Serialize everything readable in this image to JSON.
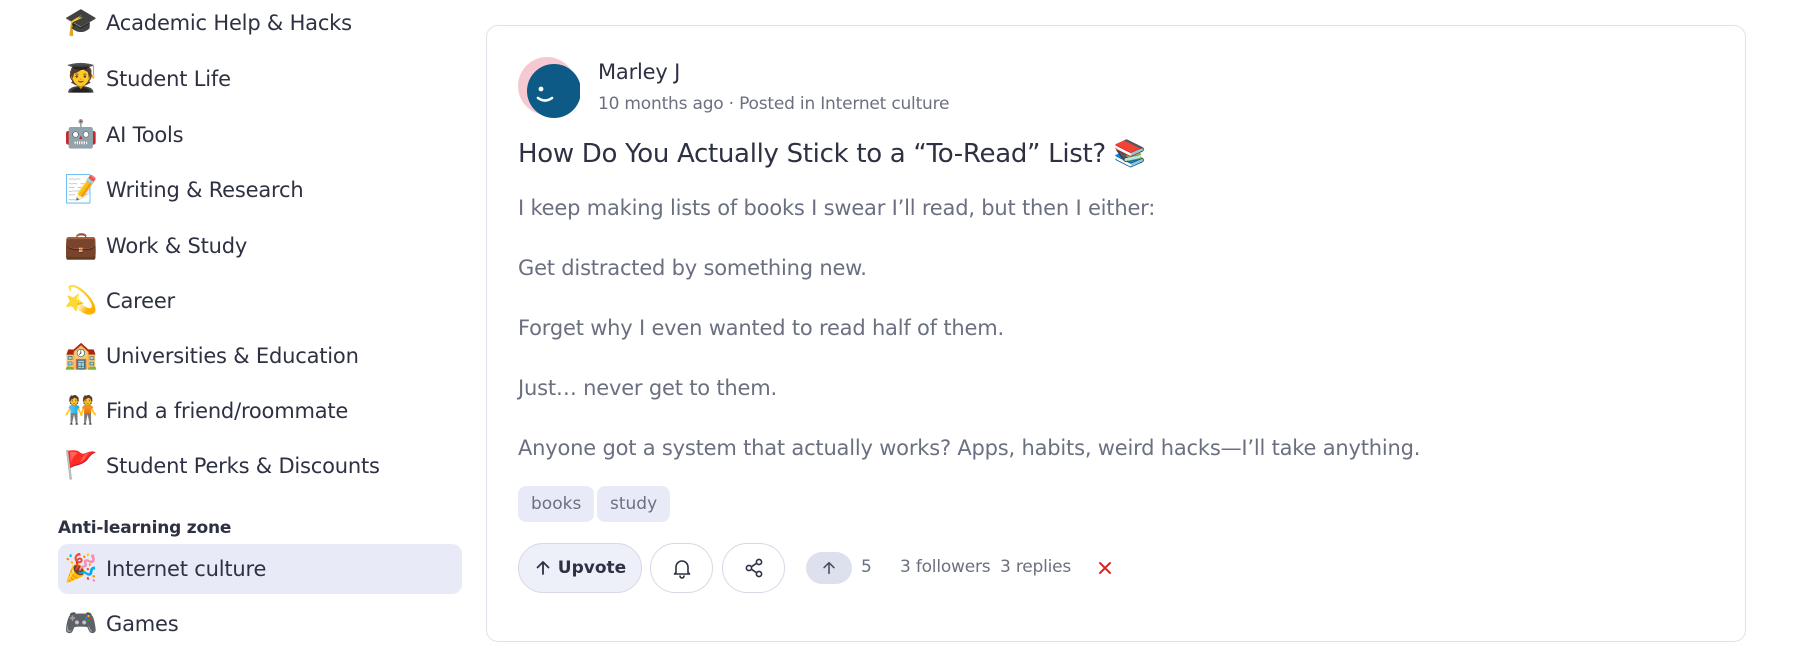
{
  "sidebar": {
    "items": [
      {
        "emoji": "🎓",
        "label": "Academic Help & Hacks"
      },
      {
        "emoji": "🧑‍🎓",
        "label": "Student Life"
      },
      {
        "emoji": "🤖",
        "label": "AI Tools"
      },
      {
        "emoji": "📝",
        "label": "Writing & Research"
      },
      {
        "emoji": "💼",
        "label": "Work & Study"
      },
      {
        "emoji": "💫",
        "label": "Career"
      },
      {
        "emoji": "🏫",
        "label": "Universities & Education"
      },
      {
        "emoji": "🧑‍🤝‍🧑",
        "label": "Find a friend/roommate"
      },
      {
        "emoji": "🚩",
        "label": "Student Perks & Discounts"
      }
    ],
    "section_heading": "Anti-learning zone",
    "zone_items": [
      {
        "emoji": "🎉",
        "label": "Internet culture",
        "active": true
      },
      {
        "emoji": "🎮",
        "label": "Games"
      }
    ]
  },
  "post": {
    "author": "Marley J",
    "meta": "10 months ago · Posted in Internet culture",
    "title": "How Do You Actually Stick to a “To-Read” List? 📚",
    "body": [
      "I keep making lists of books I swear I’ll read, but then I either:",
      "Get distracted by something new.",
      "Forget why I even wanted to read half of them.",
      "Just… never get to them.",
      "Anyone got a system that actually works? Apps, habits, weird hacks—I’ll take anything."
    ],
    "tags": [
      "books",
      "study"
    ],
    "actions": {
      "upvote_label": "Upvote",
      "vote_count": "5",
      "followers": "3 followers",
      "replies": "3 replies"
    }
  },
  "colors": {
    "accent_bg": "#e8ebf7",
    "avatar_blue": "#0d5a86",
    "avatar_pink": "#f6c9d2",
    "close_red": "#e02424"
  }
}
